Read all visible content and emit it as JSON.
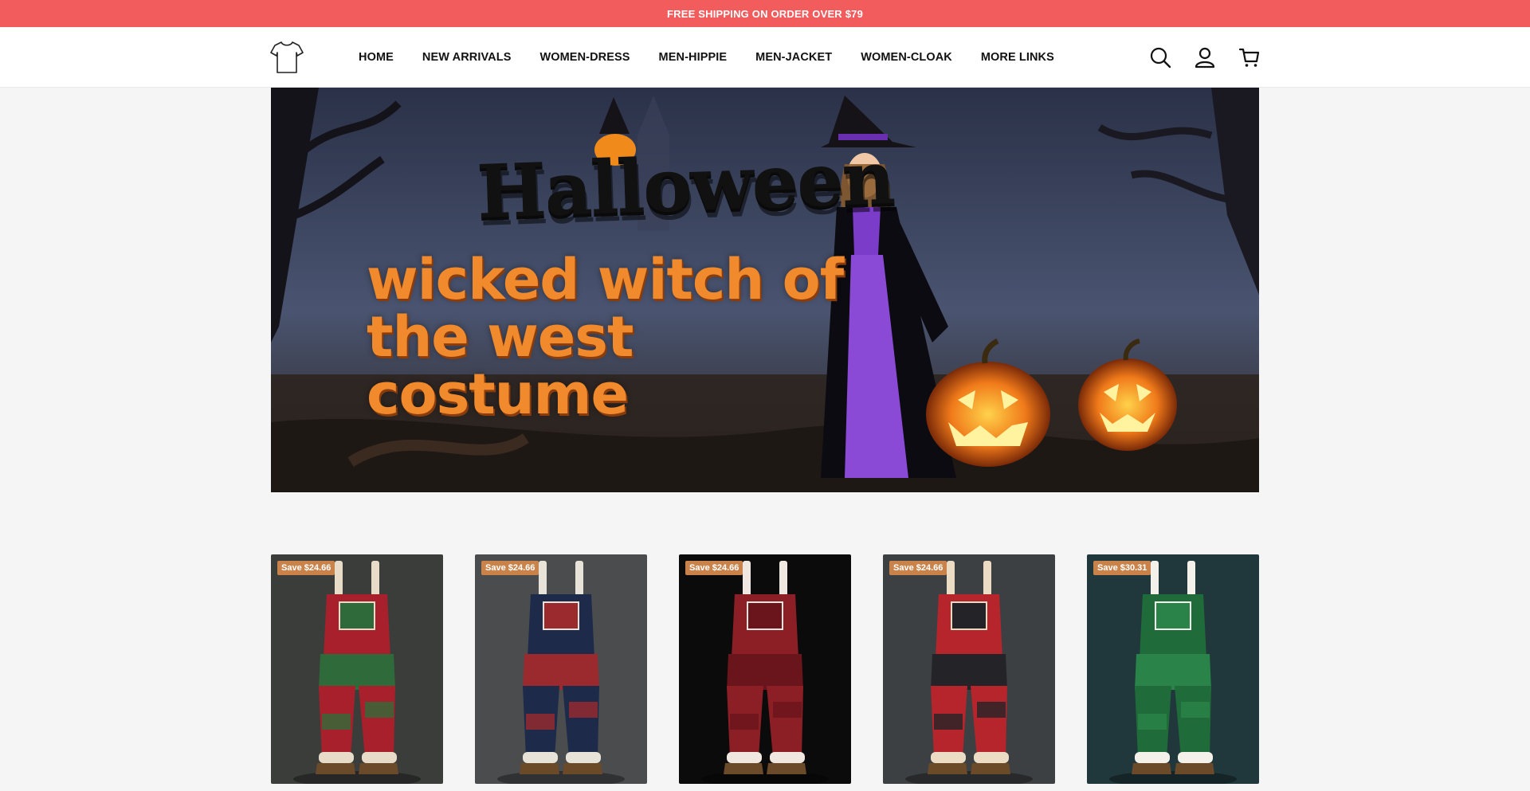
{
  "announcement": "FREE SHIPPING ON ORDER OVER $79",
  "nav": {
    "items": [
      "HOME",
      "NEW ARRIVALS",
      "WOMEN-DRESS",
      "MEN-HIPPIE",
      "MEN-JACKET",
      "WOMEN-CLOAK",
      "MORE LINKS"
    ]
  },
  "header_icons": [
    "tshirt-logo-icon",
    "search-icon",
    "account-icon",
    "cart-icon"
  ],
  "hero": {
    "title": "Halloween",
    "subtitle": "wicked witch of the west costume",
    "title_color": "#111111",
    "subtitle_color": "#f08a2c"
  },
  "products": [
    {
      "badge": "Save $24.66",
      "bg": "#3b3d3b",
      "colors": [
        "#a8202c",
        "#2f6b3a",
        "#e8dcc8"
      ]
    },
    {
      "badge": "Save $24.66",
      "bg": "#4a4c4d",
      "colors": [
        "#1e2a4a",
        "#9a2a2e",
        "#e8e3d8"
      ]
    },
    {
      "badge": "Save $24.66",
      "bg": "#0b0b0b",
      "colors": [
        "#8c1f26",
        "#6a141b",
        "#f0e8e0"
      ]
    },
    {
      "badge": "Save $24.66",
      "bg": "#3d4043",
      "colors": [
        "#b6242c",
        "#242428",
        "#ecdcc4"
      ]
    },
    {
      "badge": "Save $30.31",
      "bg": "#20383c",
      "colors": [
        "#1f6b3a",
        "#2a8449",
        "#f4f1ea"
      ]
    }
  ],
  "colors": {
    "announcement_bg": "#f25c5c",
    "badge_bg": "#c9834a"
  }
}
